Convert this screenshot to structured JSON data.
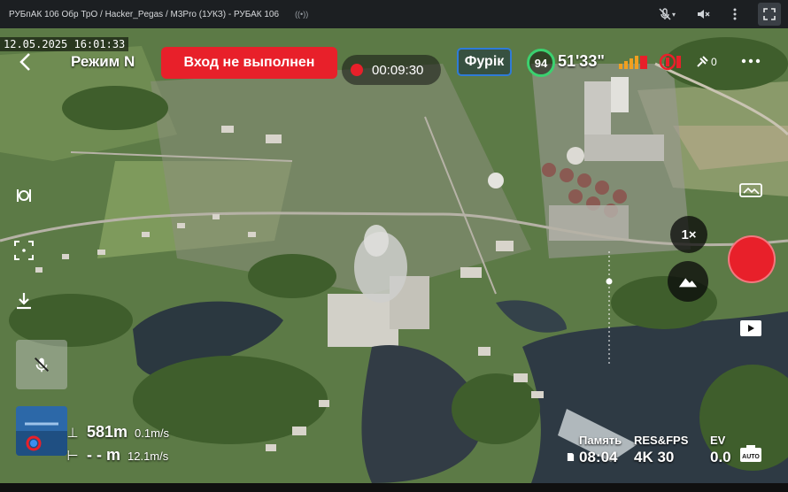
{
  "window": {
    "title": "РУБпАК 106 Обр ТрО / Hacker_Pegas / M3Pro (1УКЗ) - РУБАК 106",
    "cast_indicator": "((•))"
  },
  "window_controls": {
    "mic_icon": "mic-off-icon",
    "speaker_icon": "speaker-muted-icon",
    "menu_icon": "kebab-menu-icon",
    "fullscreen_icon": "fullscreen-icon"
  },
  "video": {
    "timestamp": "12.05.2025 16:01:33"
  },
  "osd": {
    "mode_label": "Режим N",
    "login_banner": "Вход не выполнен",
    "record_time": "00:09:30",
    "pilot_name": "Фурік",
    "battery_percent": "94",
    "flight_time": "51'33\"",
    "satellites": "0",
    "colors": {
      "alert_red": "#e8202a",
      "battery_green": "#3bd16f",
      "pilot_blue": "#2f7bd8"
    }
  },
  "telemetry": {
    "altitude_value": "581m",
    "vertical_speed": "0.1m/s",
    "distance_value": "- - m",
    "horizontal_speed": "12.1m/s"
  },
  "controls": {
    "zoom_label": "1×"
  },
  "stats": {
    "memory_label": "Память",
    "memory_value": "08:04",
    "res_label": "RES&FPS",
    "res_value": "4K 30",
    "ev_label": "EV",
    "ev_value": "0.0"
  }
}
